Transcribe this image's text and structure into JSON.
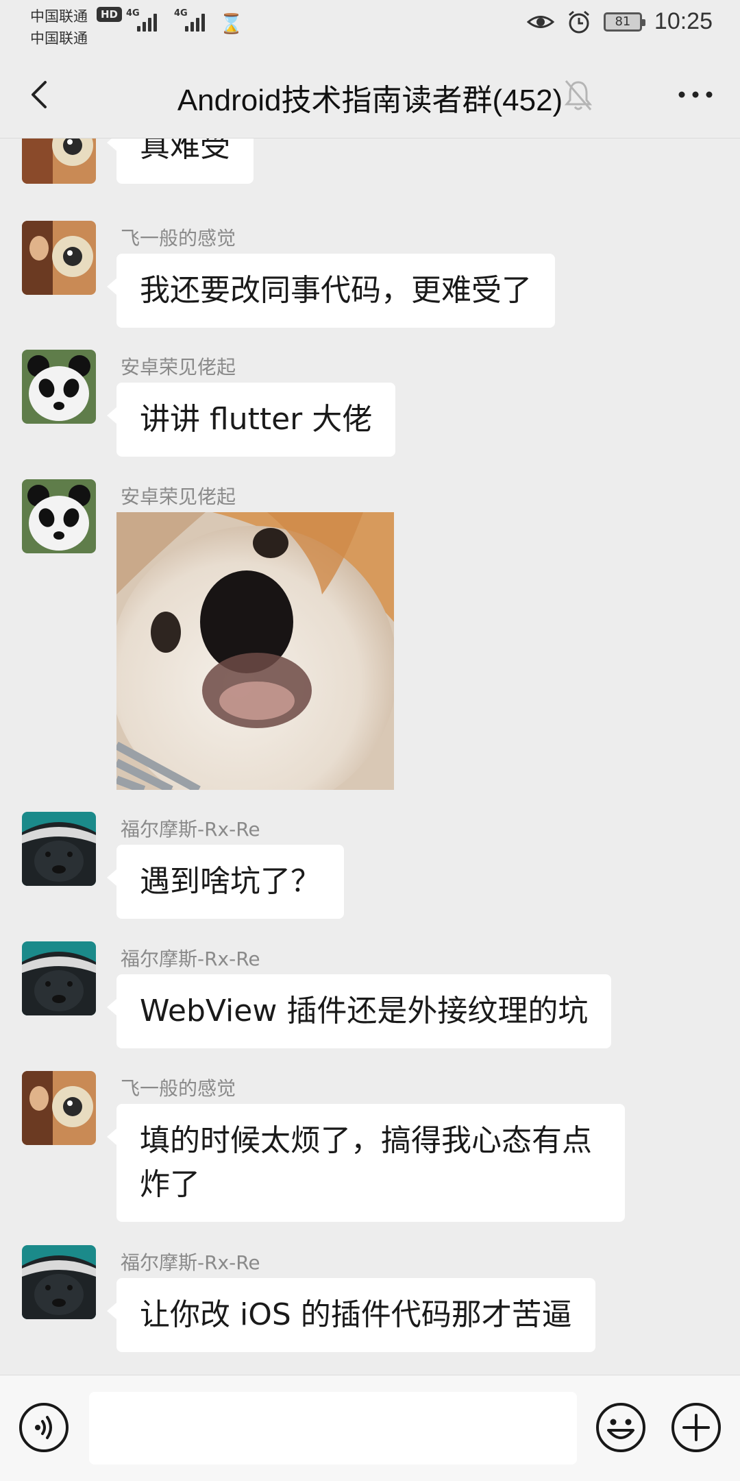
{
  "status_bar": {
    "carrier1": "中国联通",
    "carrier2": "中国联通",
    "hd": "HD",
    "net1": "4G",
    "net2": "4G",
    "battery": "81",
    "time": "10:25"
  },
  "header": {
    "title": "Android技术指南读者群(452)"
  },
  "messages": [
    {
      "sender": "",
      "text": "真难受",
      "avatar": "avatar-feiyiban"
    },
    {
      "sender": "飞一般的感觉",
      "text": "我还要改同事代码，更难受了",
      "avatar": "avatar-feiyiban"
    },
    {
      "sender": "安卓荣见佬起",
      "text": "讲讲 flutter 大佬",
      "avatar": "avatar-panda"
    },
    {
      "sender": "安卓荣见佬起",
      "text": "",
      "image": "puppy-photo",
      "avatar": "avatar-panda"
    },
    {
      "sender": "福尔摩斯-Rx-Re",
      "text": "遇到啥坑了？",
      "avatar": "avatar-honey-badger"
    },
    {
      "sender": "福尔摩斯-Rx-Re",
      "text": "WebView 插件还是外接纹理的坑",
      "avatar": "avatar-honey-badger"
    },
    {
      "sender": "飞一般的感觉",
      "text_line1": "填的时候太烦了，搞得我心态有点",
      "text_line2": "炸了",
      "avatar": "avatar-feiyiban"
    },
    {
      "sender": "福尔摩斯-Rx-Re",
      "text": "让你改 iOS 的插件代码那才苦逼",
      "avatar": "avatar-honey-badger"
    }
  ],
  "input_bar": {
    "voice_icon": "voice-icon",
    "emoji_icon": "emoji-icon",
    "plus_icon": "plus-icon",
    "draft": ""
  },
  "icons": {
    "back": "back-arrow-icon",
    "mute": "mute-bell-icon",
    "more": "more-icon"
  }
}
